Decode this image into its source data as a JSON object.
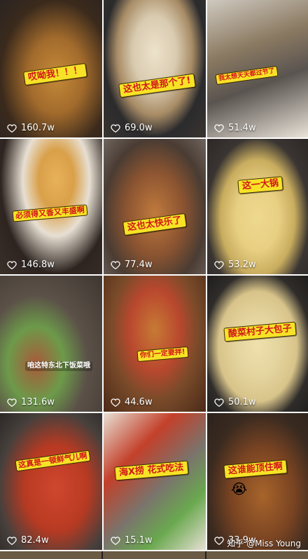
{
  "tiles": [
    {
      "caption": "哎呦我！！！",
      "likes": "160.7w",
      "bg": [
        "#3b2a1c",
        "#a36b2c",
        "#c58a3a",
        "#2a2422"
      ]
    },
    {
      "caption": "这也太是那个了!",
      "likes": "69.0w",
      "bg": [
        "#2b2b2d",
        "#d9cbb0",
        "#a88c66",
        "#39342f"
      ]
    },
    {
      "caption": "我太想天天都过节了",
      "likes": "51.4w",
      "bg": [
        "#5a5450",
        "#e9e3d9",
        "#8b7a62",
        "#cfc9c0"
      ]
    },
    {
      "caption": "必须得又香又丰盛啊",
      "likes": "146.8w",
      "bg": [
        "#2d2420",
        "#d9a049",
        "#e7dfd2",
        "#3a302a"
      ]
    },
    {
      "caption": "这也太快乐了",
      "likes": "77.4w",
      "bg": [
        "#4a3c33",
        "#c07a3d",
        "#8b5431",
        "#6f6660"
      ]
    },
    {
      "caption": "这一大锅",
      "likes": "53.2w",
      "bg": [
        "#3a3532",
        "#e8cf82",
        "#c9ad5f",
        "#2b2725"
      ]
    },
    {
      "caption": "咱这特东北下饭菜哦",
      "likes": "131.6w",
      "bg": [
        "#5b5148",
        "#a85a3a",
        "#6d9a4a",
        "#3e3631"
      ]
    },
    {
      "caption": "你们一定要拌!",
      "likes": "44.6w",
      "bg": [
        "#4a2a18",
        "#c77a35",
        "#b9482e",
        "#7a4b2a"
      ]
    },
    {
      "caption": "酸菜村子大包子",
      "likes": "50.1w",
      "bg": [
        "#2f2c2a",
        "#e4d49e",
        "#d8c48a",
        "#1f1d1b"
      ]
    },
    {
      "caption": "这真是一顿鲜气儿啊",
      "likes": "82.4w",
      "bg": [
        "#2a2826",
        "#d0462e",
        "#b83a22",
        "#47403c"
      ]
    },
    {
      "caption": "海X捞 花式吃法",
      "likes": "15.1w",
      "bg": [
        "#7a746c",
        "#c3402a",
        "#6aa84f",
        "#e7e0d4"
      ]
    },
    {
      "caption": "这谁能顶住啊",
      "likes": "33.9w",
      "bg": [
        "#3a2a20",
        "#a7642b",
        "#7a4422",
        "#2b221c"
      ]
    }
  ],
  "emoji": "😭",
  "watermark": "知乎 @Miss Young"
}
